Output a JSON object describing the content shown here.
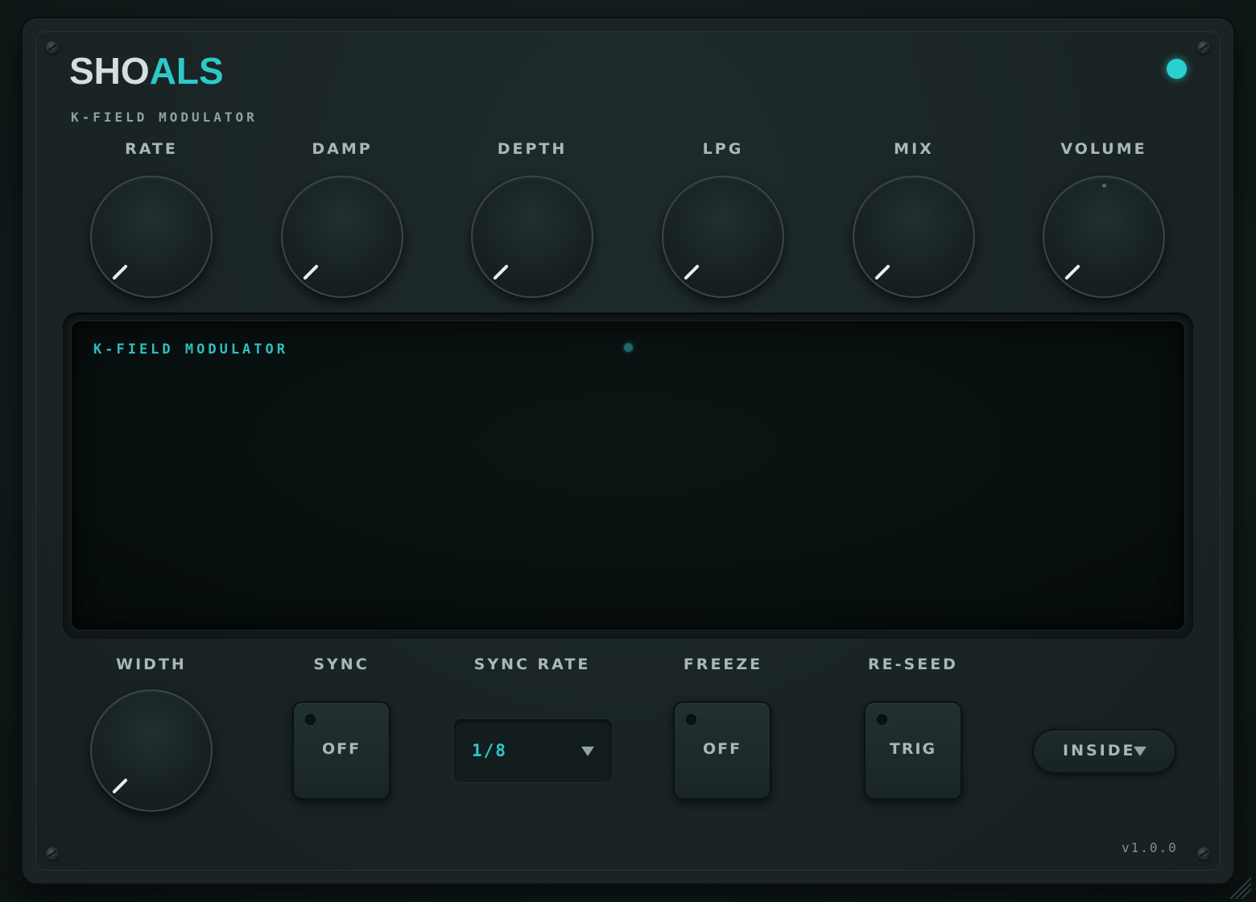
{
  "brand": {
    "logo_part1": "SHO",
    "logo_part2": "ALS",
    "subtitle": "K-FIELD MODULATOR",
    "accent_color": "#2cc9c9"
  },
  "knobs_top": [
    {
      "label": "RATE",
      "value": 0.0
    },
    {
      "label": "DAMP",
      "value": 0.0
    },
    {
      "label": "DEPTH",
      "value": 0.0
    },
    {
      "label": "LPG",
      "value": 0.0
    },
    {
      "label": "MIX",
      "value": 0.0
    },
    {
      "label": "VOLUME",
      "value": 0.0
    }
  ],
  "display": {
    "title": "K-FIELD MODULATOR"
  },
  "bottom": {
    "width": {
      "label": "WIDTH",
      "value": 0.0
    },
    "sync": {
      "label": "SYNC",
      "state": "OFF"
    },
    "sync_rate": {
      "label": "SYNC RATE",
      "value": "1/8"
    },
    "freeze": {
      "label": "FREEZE",
      "state": "OFF"
    },
    "reseed": {
      "label": "RE-SEED",
      "state": "TRIG"
    },
    "mode": {
      "value": "INSIDE"
    }
  },
  "version": "v1.0.0"
}
